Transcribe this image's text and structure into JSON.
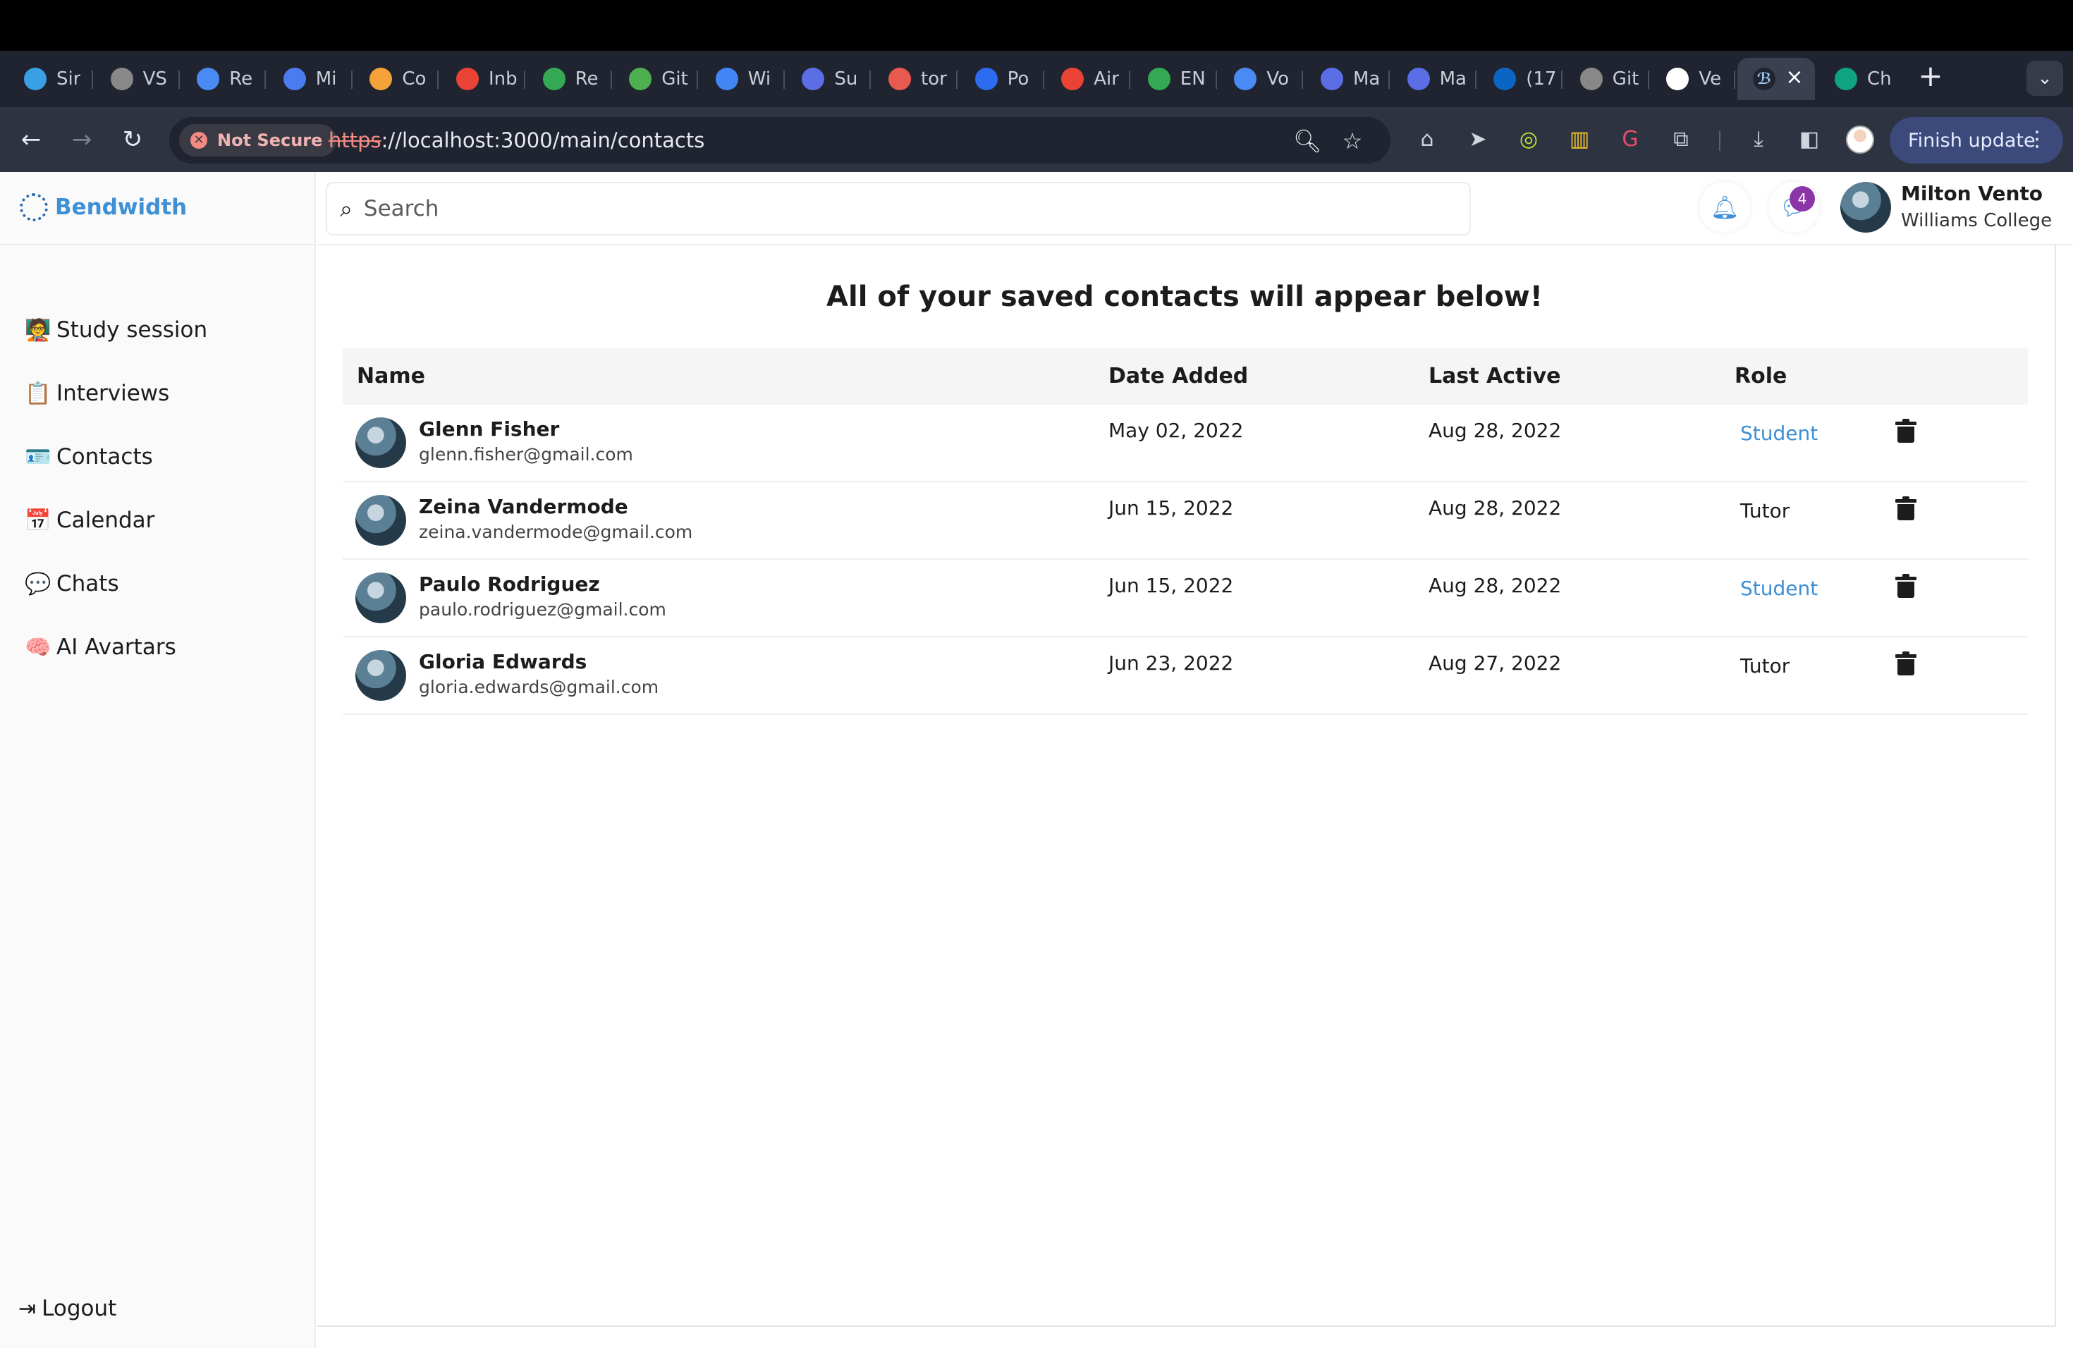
{
  "browser": {
    "tabs": [
      {
        "label": "Sir",
        "icon": "bolt-favicon",
        "color": "#3aa0e6"
      },
      {
        "label": "VS",
        "icon": "gear-favicon",
        "color": "#888888"
      },
      {
        "label": "Re",
        "icon": "drive-favicon",
        "color": "#4a8af4"
      },
      {
        "label": "Mi",
        "icon": "docs-favicon",
        "color": "#4a7cf0"
      },
      {
        "label": "Co",
        "icon": "layers-favicon",
        "color": "#f4a23a"
      },
      {
        "label": "Inb",
        "icon": "gmail-favicon",
        "color": "#ea4335"
      },
      {
        "label": "Re",
        "icon": "drive-favicon",
        "color": "#34a853"
      },
      {
        "label": "Git",
        "icon": "github-favicon",
        "color": "#4caf50"
      },
      {
        "label": "Wi",
        "icon": "calendar-favicon",
        "color": "#4285f4"
      },
      {
        "label": "Su",
        "icon": "layers-favicon",
        "color": "#5b6ee6"
      },
      {
        "label": "tor",
        "icon": "target-favicon",
        "color": "#e85a4f"
      },
      {
        "label": "Po",
        "icon": "zoom-favicon",
        "color": "#2d6cf0"
      },
      {
        "label": "Air",
        "icon": "pinwheel-favicon",
        "color": "#ea4335"
      },
      {
        "label": "EN",
        "icon": "drive-favicon",
        "color": "#34a853"
      },
      {
        "label": "Vo",
        "icon": "drive-favicon",
        "color": "#4a8af4"
      },
      {
        "label": "Ma",
        "icon": "layers-favicon",
        "color": "#5b6ee6"
      },
      {
        "label": "Ma",
        "icon": "layers-favicon",
        "color": "#5b6ee6"
      },
      {
        "label": "(17",
        "icon": "linkedin-favicon",
        "color": "#0a66c2"
      },
      {
        "label": "Git",
        "icon": "spinner-favicon",
        "color": "#888888"
      },
      {
        "label": "Ve",
        "icon": "github-favicon",
        "color": "#ffffff"
      }
    ],
    "active_tab_icon": "bendwidth-favicon",
    "last_tab": {
      "label": "Ch",
      "icon": "chatgpt-favicon",
      "color": "#10a37f"
    },
    "security_label": "Not Secure",
    "url_protocol": "https",
    "url_rest": "://localhost:3000/main/contacts",
    "update_label": "Finish update"
  },
  "app": {
    "brand": "Bendwidth",
    "nav": [
      {
        "label": "Study session",
        "icon": "chalkboard-teacher-icon",
        "glyph": "🧑‍🏫"
      },
      {
        "label": "Interviews",
        "icon": "clipboard-icon",
        "glyph": "📋"
      },
      {
        "label": "Contacts",
        "icon": "address-card-icon",
        "glyph": "🪪"
      },
      {
        "label": "Calendar",
        "icon": "calendar-icon",
        "glyph": "📅"
      },
      {
        "label": "Chats",
        "icon": "chat-bubble-icon",
        "glyph": "💬"
      },
      {
        "label": "AI Avartars",
        "icon": "brain-icon",
        "glyph": "🧠"
      }
    ],
    "logout_label": "Logout",
    "search_placeholder": "Search",
    "message_count": "4",
    "user": {
      "name": "Milton Vento",
      "school": "Williams College"
    },
    "page_title": "All of your saved contacts will appear below!",
    "columns": {
      "name": "Name",
      "date_added": "Date Added",
      "last_active": "Last Active",
      "role": "Role"
    },
    "contacts": [
      {
        "name": "Glenn Fisher",
        "email": "glenn.fisher@gmail.com",
        "date_added": "May 02, 2022",
        "last_active": "Aug 28, 2022",
        "role": "Student"
      },
      {
        "name": "Zeina Vandermode",
        "email": "zeina.vandermode@gmail.com",
        "date_added": "Jun 15, 2022",
        "last_active": "Aug 28, 2022",
        "role": "Tutor"
      },
      {
        "name": "Paulo Rodriguez",
        "email": "paulo.rodriguez@gmail.com",
        "date_added": "Jun 15, 2022",
        "last_active": "Aug 28, 2022",
        "role": "Student"
      },
      {
        "name": "Gloria Edwards",
        "email": "gloria.edwards@gmail.com",
        "date_added": "Jun 23, 2022",
        "last_active": "Aug 27, 2022",
        "role": "Tutor"
      }
    ],
    "colors": {
      "accent": "#3d8fd6",
      "badge": "#8b35a8"
    }
  }
}
